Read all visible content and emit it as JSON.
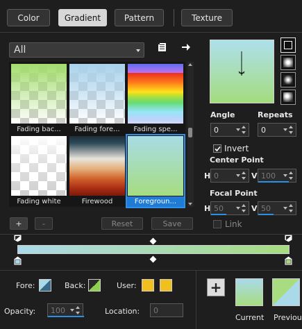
{
  "tabs": [
    {
      "label": "Color",
      "active": false
    },
    {
      "label": "Gradient",
      "active": true
    },
    {
      "label": "Pattern",
      "active": false
    },
    {
      "label": "Texture",
      "active": false
    }
  ],
  "gallery": {
    "filter": "All",
    "items": [
      {
        "label": "Fading bac...",
        "selected": false
      },
      {
        "label": "Fading fore...",
        "selected": false
      },
      {
        "label": "Fading spe...",
        "selected": false
      },
      {
        "label": "Fading white",
        "selected": false
      },
      {
        "label": "Firewood",
        "selected": false
      },
      {
        "label": "Foregroun...",
        "selected": true
      }
    ]
  },
  "gallery_buttons": {
    "add": "+",
    "remove": "-",
    "reset": "Reset",
    "save": "Save"
  },
  "properties": {
    "angle_label": "Angle",
    "angle_value": "0",
    "repeats_label": "Repeats",
    "repeats_value": "0",
    "invert_label": "Invert",
    "invert_checked": true,
    "center_point_label": "Center Point",
    "center_h_label": "H",
    "center_h_value": "0",
    "center_v_label": "V",
    "center_v_value": "100",
    "focal_point_label": "Focal Point",
    "focal_h_label": "H",
    "focal_h_value": "50",
    "focal_v_label": "V",
    "focal_v_value": "50",
    "link_label": "Link",
    "link_checked": false
  },
  "bottom": {
    "fore_label": "Fore:",
    "back_label": "Back:",
    "user_label": "User:",
    "opacity_label": "Opacity:",
    "opacity_value": "100",
    "location_label": "Location:",
    "location_value": "0",
    "current_label": "Current",
    "previous_label": "Previous",
    "add_symbol": "+"
  },
  "colors": {
    "accent": "#2d8fe5",
    "gradient_start": "#aadaea",
    "gradient_end": "#a7dc80",
    "user_color": "#f2c01e"
  }
}
